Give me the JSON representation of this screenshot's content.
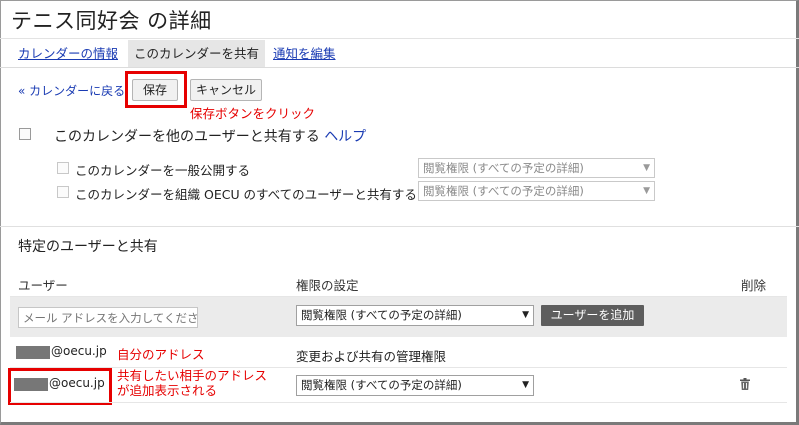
{
  "page": {
    "title": "テニス同好会 の詳細"
  },
  "tabs": [
    {
      "label": "カレンダーの情報"
    },
    {
      "label": "このカレンダーを共有"
    },
    {
      "label": "通知を編集"
    }
  ],
  "toolbar": {
    "back_label": "« カレンダーに戻る",
    "save_label": "保存",
    "cancel_label": "キャンセル",
    "save_annotation": "保存ボタンをクリック"
  },
  "sharing": {
    "share_others_label": "このカレンダーを他のユーザーと共有する",
    "help_label": "ヘルプ",
    "public_label": "このカレンダーを一般公開する",
    "public_permission": "閲覧権限 (すべての予定の詳細)",
    "org_label": "このカレンダーを組織 OECU のすべてのユーザーと共有する",
    "org_permission": "閲覧権限 (すべての予定の詳細)"
  },
  "specific": {
    "section_title": "特定のユーザーと共有",
    "col_user": "ユーザー",
    "col_permission": "権限の設定",
    "col_delete": "削除",
    "email_placeholder": "メール アドレスを入力してください",
    "new_permission": "閲覧権限 (すべての予定の詳細)",
    "add_user_label": "ユーザーを追加",
    "users": [
      {
        "email": "@oecu.jp",
        "permission": "変更および共有の管理権限",
        "annotation": "自分のアドレス"
      },
      {
        "email": "@oecu.jp",
        "permission": "閲覧権限 (すべての予定の詳細)",
        "annotation_line1": "共有したい相手のアドレス",
        "annotation_line2": "が追加表示される"
      }
    ]
  },
  "colors": {
    "link": "#1a3bb3",
    "annotation_red": "#e60000",
    "add_button_bg": "#5d5d5d"
  }
}
